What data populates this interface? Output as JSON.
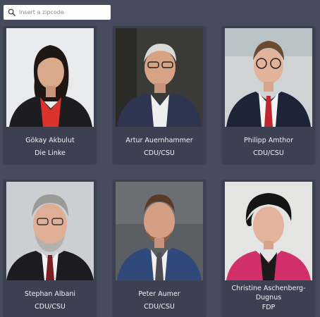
{
  "search": {
    "placeholder": "Insert a zipcode",
    "value": ""
  },
  "candidates": [
    {
      "name": "Gökay Akbulut",
      "party": "Die Linke"
    },
    {
      "name": "Artur Auernhammer",
      "party": "CDU/CSU"
    },
    {
      "name": "Philipp Amthor",
      "party": "CDU/CSU"
    },
    {
      "name": "Stephan Albani",
      "party": "CDU/CSU"
    },
    {
      "name": "Peter Aumer",
      "party": "CDU/CSU"
    },
    {
      "name": "Christine Aschenberg-Dugnus",
      "party": "FDP"
    }
  ]
}
